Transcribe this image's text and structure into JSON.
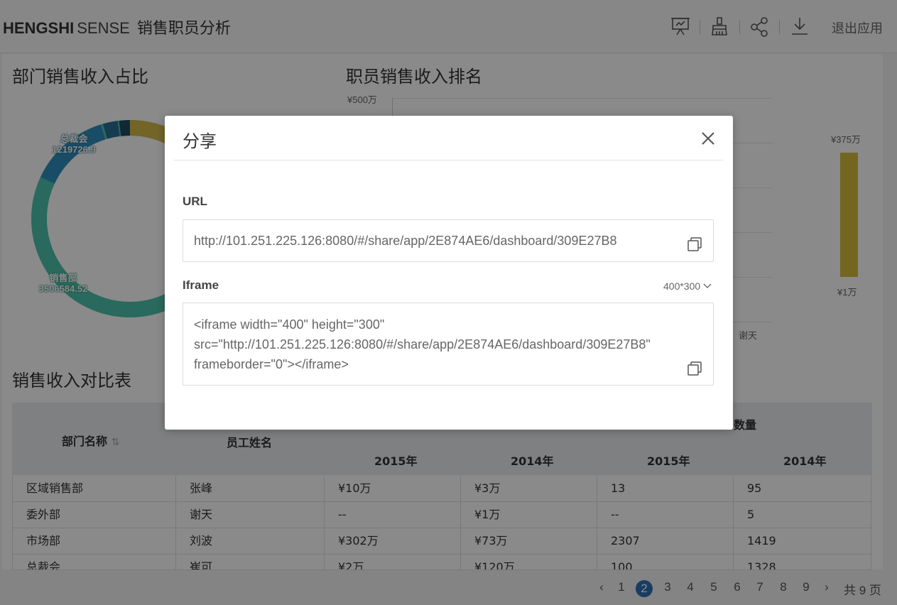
{
  "header": {
    "brand_bold": "HENGSHI",
    "brand_light": "SENSE",
    "dashboard_title": "销售职员分析",
    "icons": [
      "presentation-icon",
      "clean-icon",
      "share-icon",
      "download-icon"
    ],
    "exit_label": "退出应用"
  },
  "donut_panel": {
    "title": "部门销售收入占比",
    "labels": [
      {
        "name": "总裁会",
        "value": "1219726.9"
      },
      {
        "name": "销售部",
        "value": "3506584.52"
      }
    ],
    "colors": {
      "top_accent": "#d4b94a",
      "blue": "#2f8fbf",
      "teal": "#4fc2ac",
      "dark": "#1f4a66"
    }
  },
  "ranking_panel": {
    "title": "职员销售收入排名",
    "y_top_label": "¥500万",
    "x_visible_label": "谢天",
    "legend_max": "¥375万",
    "legend_min": "¥1万",
    "legend_color": "#d4bd3e"
  },
  "table_panel": {
    "title": "销售收入对比表",
    "headers": {
      "dept": "部门名称",
      "employee": "员工姓名",
      "group_visible_suffix": "数量",
      "years": [
        "2015年",
        "2014年",
        "2015年",
        "2014年"
      ]
    },
    "rows": [
      [
        "区域销售部",
        "张峰",
        "¥10万",
        "¥3万",
        "13",
        "95"
      ],
      [
        "委外部",
        "谢天",
        "--",
        "¥1万",
        "--",
        "5"
      ],
      [
        "市场部",
        "刘波",
        "¥302万",
        "¥73万",
        "2307",
        "1419"
      ],
      [
        "总裁会",
        "崔可",
        "¥2万",
        "¥120万",
        "100",
        "1328"
      ]
    ]
  },
  "pagination": {
    "prev": "‹",
    "pages": [
      "1",
      "2",
      "3",
      "4",
      "5",
      "6",
      "7",
      "8",
      "9"
    ],
    "current": "2",
    "next": "›",
    "total_text": "共 9 页"
  },
  "share_modal": {
    "title": "分享",
    "url_label": "URL",
    "url_value": "http://101.251.225.126:8080/#/share/app/2E874AE6/dashboard/309E27B8",
    "iframe_label": "Iframe",
    "iframe_size": "400*300",
    "iframe_code_line1": "<iframe width=\"400\" height=\"300\"",
    "iframe_code_line2": "src=\"http://101.251.225.126:8080/#/share/app/2E874AE6/dashboard/309E27B8\"",
    "iframe_code_line3": "frameborder=\"0\"></iframe>"
  }
}
